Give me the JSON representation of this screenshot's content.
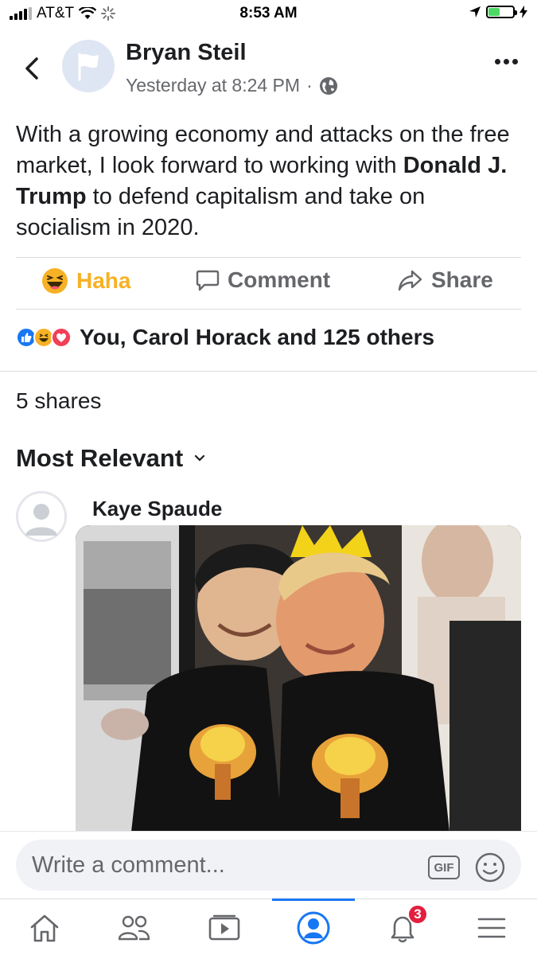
{
  "status_bar": {
    "carrier": "AT&T",
    "time": "8:53 AM"
  },
  "post": {
    "author": "Bryan Steil",
    "timestamp": "Yesterday at 8:24 PM",
    "separator": "·",
    "privacy_icon": "globe-icon",
    "text_part1": "With a growing economy and attacks on the free market, I look forward to working with ",
    "mention": "Donald J. Trump",
    "text_part2": " to defend capitalism and take on socialism in 2020."
  },
  "actions": {
    "haha_label": "Haha",
    "comment_label": "Comment",
    "share_label": "Share"
  },
  "reactions": {
    "summary": "You, Carol Horack and 125 others",
    "icons": [
      "like-icon",
      "haha-icon",
      "love-icon"
    ]
  },
  "shares_text": "5 shares",
  "sort": {
    "label": "Most Relevant"
  },
  "comment": {
    "author": "Kaye Spaude",
    "media": "gif-image"
  },
  "composer": {
    "placeholder": "Write a comment...",
    "gif_label": "GIF"
  },
  "tab_bar": {
    "active_tab": "profile",
    "notifications_count": "3"
  },
  "colors": {
    "brand": "#1877f2",
    "haha": "#f7b125",
    "badge": "#e41e3f",
    "secondary_text": "#65676b"
  }
}
